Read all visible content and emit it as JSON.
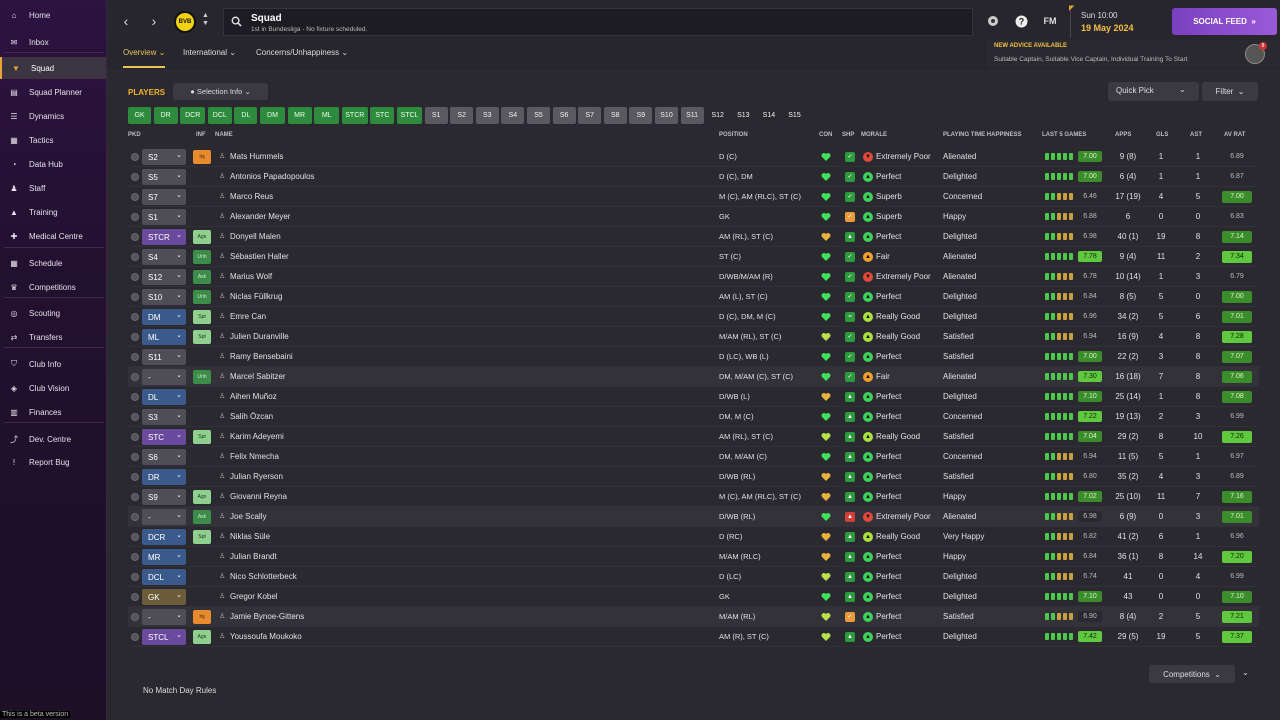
{
  "colors": {
    "accent": "#f0b429",
    "social": "#8a4dd0",
    "green": "#2e8b3e",
    "purple": "#6a4a9c",
    "blue": "#3a5a8c",
    "olive": "#6b5d3a",
    "grey": "#4f4e56"
  },
  "sidebar": {
    "items": [
      {
        "label": "Home",
        "icon": "home-icon"
      },
      {
        "label": "Inbox",
        "icon": "inbox-icon"
      },
      {
        "label": "Squad",
        "icon": "shirt-icon",
        "active": true
      },
      {
        "label": "Squad Planner",
        "icon": "planner-icon"
      },
      {
        "label": "Dynamics",
        "icon": "dynamics-icon"
      },
      {
        "label": "Tactics",
        "icon": "tactics-icon"
      },
      {
        "label": "Data Hub",
        "icon": "data-hub-icon"
      },
      {
        "label": "Staff",
        "icon": "staff-icon"
      },
      {
        "label": "Training",
        "icon": "training-icon"
      },
      {
        "label": "Medical Centre",
        "icon": "medical-icon"
      },
      {
        "label": "Schedule",
        "icon": "calendar-icon"
      },
      {
        "label": "Competitions",
        "icon": "trophy-icon"
      },
      {
        "label": "Scouting",
        "icon": "scouting-icon"
      },
      {
        "label": "Transfers",
        "icon": "transfers-icon"
      },
      {
        "label": "Club Info",
        "icon": "shield-icon"
      },
      {
        "label": "Club Vision",
        "icon": "vision-icon"
      },
      {
        "label": "Finances",
        "icon": "finances-icon"
      },
      {
        "label": "Dev. Centre",
        "icon": "dev-centre-icon"
      },
      {
        "label": "Report Bug",
        "icon": "report-bug-icon"
      }
    ]
  },
  "beta": "This is a beta version",
  "header": {
    "club_badge": "BVB",
    "title": "Squad",
    "subtitle": "1st in Bundesliga - No fixture scheduled.",
    "fm": "FM",
    "time": "Sun 10:00",
    "date": "19 May 2024",
    "social": "SOCIAL FEED"
  },
  "tabs": [
    {
      "label": "Overview"
    },
    {
      "label": "International"
    },
    {
      "label": "Concerns/Unhappiness"
    }
  ],
  "advice": {
    "title": "NEW ADVICE AVAILABLE",
    "text": "Suitable Captain, Suitable Vice Captain, Individual Training To Start",
    "count": "8"
  },
  "toolbar": {
    "players": "PLAYERS",
    "selection_info": "Selection Info",
    "quick_pick": "Quick Pick",
    "filter": "Filter"
  },
  "positions": [
    "GK",
    "DR",
    "DCR",
    "DCL",
    "DL",
    "DM",
    "MR",
    "ML",
    "STCR",
    "STC",
    "STCL",
    "S1",
    "S2",
    "S3",
    "S4",
    "S5",
    "S6",
    "S7",
    "S8",
    "S9",
    "S10",
    "S11",
    "S12",
    "S13",
    "S14",
    "S15"
  ],
  "columns": {
    "pkd": "PKD",
    "inf": "INF",
    "name": "NAME",
    "position": "POSITION",
    "con": "CON",
    "shp": "SHP",
    "morale": "MORALE",
    "pth": "PLAYING TIME HAPPINESS",
    "last5": "LAST 5 GAMES",
    "apps": "APPS",
    "gls": "GLS",
    "ast": "AST",
    "avrat": "AV RAT"
  },
  "players": [
    {
      "pkd": "S2",
      "inf": "Inj",
      "name": "Mats Hummels",
      "position": "D (C)",
      "con": "full",
      "shp": "ok",
      "morale": "Extremely Poor",
      "pth": "Alienated",
      "l5": "7.00",
      "apps": "9 (8)",
      "gls": "1",
      "ast": "1",
      "avrat": "6.89"
    },
    {
      "pkd": "S5",
      "inf": "",
      "name": "Antonios Papadopoulos",
      "position": "D (C), DM",
      "con": "full",
      "shp": "ok",
      "morale": "Perfect",
      "pth": "Delighted",
      "l5": "7.00",
      "apps": "6 (4)",
      "gls": "1",
      "ast": "1",
      "avrat": "6.87"
    },
    {
      "pkd": "S7",
      "inf": "",
      "name": "Marco Reus",
      "position": "M (C), AM (RLC), ST (C)",
      "con": "full",
      "shp": "ok",
      "morale": "Superb",
      "pth": "Concerned",
      "l5": "6.46",
      "apps": "17 (19)",
      "gls": "4",
      "ast": "5",
      "avrat": "7.00"
    },
    {
      "pkd": "S1",
      "inf": "",
      "name": "Alexander Meyer",
      "position": "GK",
      "con": "full",
      "shp": "warn",
      "morale": "Superb",
      "pth": "Happy",
      "l5": "6.88",
      "apps": "6",
      "gls": "0",
      "ast": "0",
      "avrat": "6.83"
    },
    {
      "pkd": "STCR",
      "inf": "Agn",
      "name": "Donyell Malen",
      "position": "AM (RL), ST (C)",
      "con": "mid",
      "shp": "up",
      "morale": "Perfect",
      "pth": "Delighted",
      "l5": "6.98",
      "apps": "40 (1)",
      "gls": "19",
      "ast": "8",
      "avrat": "7.14"
    },
    {
      "pkd": "S4",
      "inf": "Unh",
      "name": "Sébastien Haller",
      "position": "ST (C)",
      "con": "full",
      "shp": "ok",
      "morale": "Fair",
      "pth": "Alienated",
      "l5": "7.78",
      "apps": "9 (4)",
      "gls": "11",
      "ast": "2",
      "avrat": "7.34"
    },
    {
      "pkd": "S12",
      "inf": "Ask",
      "name": "Marius Wolf",
      "position": "D/WB/M/AM (R)",
      "con": "full",
      "shp": "ok",
      "morale": "Extremely Poor",
      "pth": "Alienated",
      "l5": "6.78",
      "apps": "10 (14)",
      "gls": "1",
      "ast": "3",
      "avrat": "6.79"
    },
    {
      "pkd": "S10",
      "inf": "Unh",
      "name": "Niclas Füllkrug",
      "position": "AM (L), ST (C)",
      "con": "full",
      "shp": "ok",
      "morale": "Perfect",
      "pth": "Delighted",
      "l5": "6.84",
      "apps": "8 (5)",
      "gls": "5",
      "ast": "0",
      "avrat": "7.00"
    },
    {
      "pkd": "DM",
      "inf": "Spt",
      "name": "Emre Can",
      "position": "D (C), DM, M (C)",
      "con": "full",
      "shp": "eq",
      "morale": "Really Good",
      "pth": "Delighted",
      "l5": "6.96",
      "apps": "34 (2)",
      "gls": "5",
      "ast": "6",
      "avrat": "7.01"
    },
    {
      "pkd": "ML",
      "inf": "Spt",
      "name": "Julien Duranville",
      "position": "M/AM (RL), ST (C)",
      "con": "good",
      "shp": "ok",
      "morale": "Really Good",
      "pth": "Satisfied",
      "l5": "6.94",
      "apps": "16 (9)",
      "gls": "4",
      "ast": "8",
      "avrat": "7.28"
    },
    {
      "pkd": "S11",
      "inf": "",
      "name": "Ramy Bensebaini",
      "position": "D (LC), WB (L)",
      "con": "full",
      "shp": "ok",
      "morale": "Perfect",
      "pth": "Satisfied",
      "l5": "7.00",
      "apps": "22 (2)",
      "gls": "3",
      "ast": "8",
      "avrat": "7.07"
    },
    {
      "pkd": "-",
      "inf": "Unh",
      "name": "Marcel Sabitzer",
      "position": "DM, M/AM (C), ST (C)",
      "con": "full",
      "shp": "ok",
      "morale": "Fair",
      "pth": "Alienated",
      "l5": "7.30",
      "apps": "16 (18)",
      "gls": "7",
      "ast": "8",
      "avrat": "7.06",
      "hl": true
    },
    {
      "pkd": "DL",
      "inf": "",
      "name": "Aihen Muñoz",
      "position": "D/WB (L)",
      "con": "mid",
      "shp": "up",
      "morale": "Perfect",
      "pth": "Delighted",
      "l5": "7.10",
      "apps": "25 (14)",
      "gls": "1",
      "ast": "8",
      "avrat": "7.08"
    },
    {
      "pkd": "S3",
      "inf": "",
      "name": "Salih Özcan",
      "position": "DM, M (C)",
      "con": "full",
      "shp": "up",
      "morale": "Perfect",
      "pth": "Concerned",
      "l5": "7.22",
      "apps": "19 (13)",
      "gls": "2",
      "ast": "3",
      "avrat": "6.99"
    },
    {
      "pkd": "STC",
      "inf": "Spt",
      "name": "Karim Adeyemi",
      "position": "AM (RL), ST (C)",
      "con": "good",
      "shp": "up",
      "morale": "Really Good",
      "pth": "Satisfied",
      "l5": "7.04",
      "apps": "29 (2)",
      "gls": "8",
      "ast": "10",
      "avrat": "7.26"
    },
    {
      "pkd": "S6",
      "inf": "",
      "name": "Felix Nmecha",
      "position": "DM, M/AM (C)",
      "con": "full",
      "shp": "up",
      "morale": "Perfect",
      "pth": "Concerned",
      "l5": "6.94",
      "apps": "11 (5)",
      "gls": "5",
      "ast": "1",
      "avrat": "6.97"
    },
    {
      "pkd": "DR",
      "inf": "",
      "name": "Julian Ryerson",
      "position": "D/WB (RL)",
      "con": "mid",
      "shp": "up",
      "morale": "Perfect",
      "pth": "Satisfied",
      "l5": "6.80",
      "apps": "35 (2)",
      "gls": "4",
      "ast": "3",
      "avrat": "6.89"
    },
    {
      "pkd": "S9",
      "inf": "Agn",
      "name": "Giovanni Reyna",
      "position": "M (C), AM (RLC), ST (C)",
      "con": "mid",
      "shp": "up",
      "morale": "Perfect",
      "pth": "Happy",
      "l5": "7.02",
      "apps": "25 (10)",
      "gls": "11",
      "ast": "7",
      "avrat": "7.16"
    },
    {
      "pkd": "-",
      "inf": "Ask",
      "name": "Joe Scally",
      "position": "D/WB (RL)",
      "con": "full",
      "shp": "bad",
      "morale": "Extremely Poor",
      "pth": "Alienated",
      "l5": "6.98",
      "apps": "6 (9)",
      "gls": "0",
      "ast": "3",
      "avrat": "7.01",
      "hl": true
    },
    {
      "pkd": "DCR",
      "inf": "Spt",
      "name": "Niklas Süle",
      "position": "D (RC)",
      "con": "mid",
      "shp": "up",
      "morale": "Really Good",
      "pth": "Very Happy",
      "l5": "6.82",
      "apps": "41 (2)",
      "gls": "6",
      "ast": "1",
      "avrat": "6.96"
    },
    {
      "pkd": "MR",
      "inf": "",
      "name": "Julian Brandt",
      "position": "M/AM (RLC)",
      "con": "mid",
      "shp": "up",
      "morale": "Perfect",
      "pth": "Happy",
      "l5": "6.84",
      "apps": "36 (1)",
      "gls": "8",
      "ast": "14",
      "avrat": "7.20"
    },
    {
      "pkd": "DCL",
      "inf": "",
      "name": "Nico Schlotterbeck",
      "position": "D (LC)",
      "con": "good",
      "shp": "up",
      "morale": "Perfect",
      "pth": "Delighted",
      "l5": "6.74",
      "apps": "41",
      "gls": "0",
      "ast": "4",
      "avrat": "6.99"
    },
    {
      "pkd": "GK",
      "inf": "",
      "name": "Gregor Kobel",
      "position": "GK",
      "con": "full",
      "shp": "up",
      "morale": "Perfect",
      "pth": "Delighted",
      "l5": "7.10",
      "apps": "43",
      "gls": "0",
      "ast": "0",
      "avrat": "7.10"
    },
    {
      "pkd": "-",
      "inf": "Inj",
      "name": "Jamie Bynoe-Gittens",
      "position": "M/AM (RL)",
      "con": "good",
      "shp": "warn",
      "morale": "Perfect",
      "pth": "Satisfied",
      "l5": "6.90",
      "apps": "8 (4)",
      "gls": "2",
      "ast": "5",
      "avrat": "7.21",
      "hl": true
    },
    {
      "pkd": "STCL",
      "inf": "Agn",
      "name": "Youssoufa Moukoko",
      "position": "AM (R), ST (C)",
      "con": "good",
      "shp": "up",
      "morale": "Perfect",
      "pth": "Delighted",
      "l5": "7.42",
      "apps": "29 (5)",
      "gls": "19",
      "ast": "5",
      "avrat": "7.37"
    }
  ],
  "footer": {
    "no_match": "No Match Day Rules",
    "competitions": "Competitions"
  }
}
